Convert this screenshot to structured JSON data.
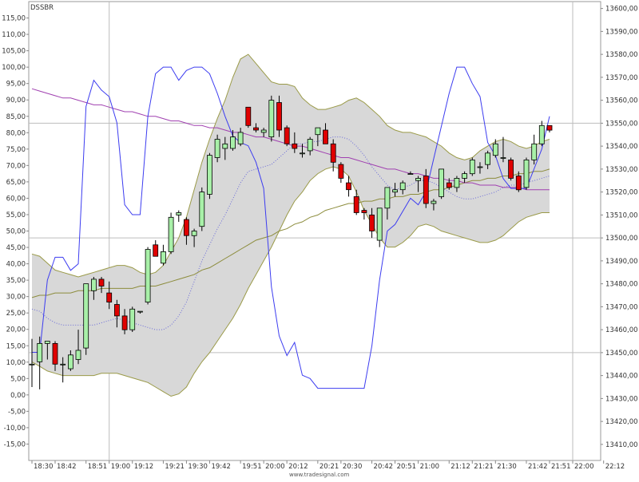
{
  "chart_data": {
    "type": "candlestick",
    "symbol": "DSSBR",
    "watermark": "www.tradesignal.com",
    "x_labels": [
      "18:30",
      "18:42",
      "18:51",
      "19:00",
      "19:12",
      "19:21",
      "19:30",
      "19:42",
      "19:51",
      "20:00",
      "20:12",
      "20:21",
      "20:30",
      "20:42",
      "20:51",
      "21:00",
      "21:12",
      "21:21",
      "21:30",
      "21:42",
      "21:51",
      "22:00",
      "22:12"
    ],
    "left_axis": {
      "range": [
        -20,
        120
      ],
      "tick_labels": [
        "115,00",
        "110,00",
        "105,00",
        "100,00",
        "95,00",
        "90,00",
        "85,00",
        "80,00",
        "75,00",
        "70,00",
        "65,00",
        "60,00",
        "55,00",
        "50,00",
        "45,00",
        "40,00",
        "35,00",
        "30,00",
        "25,00",
        "20,00",
        "15,00",
        "10,00",
        "5,00",
        "0,00",
        "-5,00",
        "-10,00",
        "-15,00"
      ]
    },
    "right_axis": {
      "range": [
        13403,
        13603
      ],
      "tick_labels": [
        "13600,00",
        "13590,00",
        "13580,00",
        "13570,00",
        "13560,00",
        "13550,00",
        "13540,00",
        "13530,00",
        "13520,00",
        "13510,00",
        "13500,00",
        "13490,00",
        "13480,00",
        "13470,00",
        "13460,00",
        "13450,00",
        "13440,00",
        "13430,00",
        "13420,00",
        "13410,00"
      ]
    },
    "grid_lines": [
      "12:00 vertical",
      "13450 / 13500 / 13550 horizontal"
    ],
    "candles": [
      {
        "o": 13445,
        "h": 13456,
        "l": 13435,
        "c": 13445
      },
      {
        "o": 13446,
        "h": 13457,
        "l": 13434,
        "c": 13454
      },
      {
        "o": 13454,
        "h": 13455,
        "l": 13447,
        "c": 13455
      },
      {
        "o": 13454,
        "h": 13455,
        "l": 13442,
        "c": 13445
      },
      {
        "o": 13445,
        "h": 13448,
        "l": 13437,
        "c": 13445
      },
      {
        "o": 13443,
        "h": 13451,
        "l": 13442,
        "c": 13449
      },
      {
        "o": 13447,
        "h": 13460,
        "l": 13445,
        "c": 13451
      },
      {
        "o": 13452,
        "h": 13480,
        "l": 13449,
        "c": 13480
      },
      {
        "o": 13477,
        "h": 13483,
        "l": 13473,
        "c": 13482
      },
      {
        "o": 13482,
        "h": 13483,
        "l": 13476,
        "c": 13479
      },
      {
        "o": 13476,
        "h": 13481,
        "l": 13469,
        "c": 13472
      },
      {
        "o": 13471,
        "h": 13473,
        "l": 13461,
        "c": 13466
      },
      {
        "o": 13466,
        "h": 13469,
        "l": 13458,
        "c": 13460
      },
      {
        "o": 13460,
        "h": 13470,
        "l": 13459,
        "c": 13469
      },
      {
        "o": 13468,
        "h": 13468,
        "l": 13467,
        "c": 13468
      },
      {
        "o": 13472,
        "h": 13496,
        "l": 13471,
        "c": 13495
      },
      {
        "o": 13497,
        "h": 13499,
        "l": 13493,
        "c": 13492
      },
      {
        "o": 13489,
        "h": 13497,
        "l": 13488,
        "c": 13494
      },
      {
        "o": 13494,
        "h": 13511,
        "l": 13493,
        "c": 13509
      },
      {
        "o": 13510,
        "h": 13512,
        "l": 13507,
        "c": 13511
      },
      {
        "o": 13508,
        "h": 13509,
        "l": 13497,
        "c": 13501
      },
      {
        "o": 13501,
        "h": 13504,
        "l": 13496,
        "c": 13503
      },
      {
        "o": 13505,
        "h": 13522,
        "l": 13503,
        "c": 13520
      },
      {
        "o": 13519,
        "h": 13537,
        "l": 13517,
        "c": 13536
      },
      {
        "o": 13535,
        "h": 13545,
        "l": 13533,
        "c": 13543
      },
      {
        "o": 13539,
        "h": 13544,
        "l": 13534,
        "c": 13541
      },
      {
        "o": 13539,
        "h": 13547,
        "l": 13538,
        "c": 13544
      },
      {
        "o": 13541,
        "h": 13548,
        "l": 13540,
        "c": 13546
      },
      {
        "o": 13557,
        "h": 13557,
        "l": 13548,
        "c": 13549
      },
      {
        "o": 13548,
        "h": 13550,
        "l": 13546,
        "c": 13547
      },
      {
        "o": 13546,
        "h": 13548,
        "l": 13544,
        "c": 13547
      },
      {
        "o": 13544,
        "h": 13562,
        "l": 13542,
        "c": 13560
      },
      {
        "o": 13559,
        "h": 13562,
        "l": 13544,
        "c": 13547
      },
      {
        "o": 13548,
        "h": 13549,
        "l": 13540,
        "c": 13541
      },
      {
        "o": 13541,
        "h": 13546,
        "l": 13537,
        "c": 13539
      },
      {
        "o": 13537,
        "h": 13541,
        "l": 13535,
        "c": 13537
      },
      {
        "o": 13538,
        "h": 13544,
        "l": 13536,
        "c": 13543
      },
      {
        "o": 13545,
        "h": 13547,
        "l": 13540,
        "c": 13548
      },
      {
        "o": 13547,
        "h": 13550,
        "l": 13541,
        "c": 13541
      },
      {
        "o": 13541,
        "h": 13543,
        "l": 13529,
        "c": 13533
      },
      {
        "o": 13532,
        "h": 13533,
        "l": 13524,
        "c": 13526
      },
      {
        "o": 13524,
        "h": 13527,
        "l": 13518,
        "c": 13521
      },
      {
        "o": 13518,
        "h": 13521,
        "l": 13510,
        "c": 13511
      },
      {
        "o": 13512,
        "h": 13513,
        "l": 13508,
        "c": 13511
      },
      {
        "o": 13510,
        "h": 13513,
        "l": 13500,
        "c": 13503
      },
      {
        "o": 13499,
        "h": 13503,
        "l": 13496,
        "c": 13513
      },
      {
        "o": 13513,
        "h": 13522,
        "l": 13508,
        "c": 13522
      },
      {
        "o": 13520,
        "h": 13524,
        "l": 13518,
        "c": 13521
      },
      {
        "o": 13521,
        "h": 13525,
        "l": 13519,
        "c": 13524
      },
      {
        "o": 13528,
        "h": 13529,
        "l": 13528,
        "c": 13528
      },
      {
        "o": 13525,
        "h": 13527,
        "l": 13520,
        "c": 13526
      },
      {
        "o": 13527,
        "h": 13530,
        "l": 13513,
        "c": 13515
      },
      {
        "o": 13515,
        "h": 13517,
        "l": 13512,
        "c": 13516
      },
      {
        "o": 13518,
        "h": 13530,
        "l": 13517,
        "c": 13530
      },
      {
        "o": 13524,
        "h": 13526,
        "l": 13521,
        "c": 13522
      },
      {
        "o": 13522,
        "h": 13527,
        "l": 13520,
        "c": 13526
      },
      {
        "o": 13526,
        "h": 13529,
        "l": 13524,
        "c": 13528
      },
      {
        "o": 13528,
        "h": 13535,
        "l": 13527,
        "c": 13534
      },
      {
        "o": 13531,
        "h": 13533,
        "l": 13528,
        "c": 13531
      },
      {
        "o": 13532,
        "h": 13538,
        "l": 13530,
        "c": 13537
      },
      {
        "o": 13536,
        "h": 13543,
        "l": 13535,
        "c": 13541
      },
      {
        "o": 13535,
        "h": 13544,
        "l": 13533,
        "c": 13535
      },
      {
        "o": 13534,
        "h": 13535,
        "l": 13525,
        "c": 13526
      },
      {
        "o": 13527,
        "h": 13529,
        "l": 13520,
        "c": 13521
      },
      {
        "o": 13522,
        "h": 13535,
        "l": 13521,
        "c": 13534
      },
      {
        "o": 13534,
        "h": 13545,
        "l": 13532,
        "c": 13541
      },
      {
        "o": 13541,
        "h": 13551,
        "l": 13540,
        "c": 13549
      },
      {
        "o": 13549,
        "h": 13549,
        "l": 13546,
        "c": 13547
      }
    ],
    "bollinger": {
      "upper": [
        13493,
        13492,
        13489,
        13486,
        13485,
        13484,
        13483,
        13484,
        13485,
        13486,
        13487,
        13488,
        13488,
        13487,
        13485,
        13484,
        13485,
        13488,
        13494,
        13500,
        13509,
        13521,
        13533,
        13543,
        13552,
        13560,
        13570,
        13578,
        13580,
        13576,
        13572,
        13568,
        13567,
        13567,
        13566,
        13561,
        13558,
        13556,
        13556,
        13557,
        13558,
        13560,
        13561,
        13559,
        13556,
        13553,
        13549,
        13547,
        13546,
        13546,
        13545,
        13544,
        13542,
        13540,
        13537,
        13535,
        13534,
        13535,
        13538,
        13540,
        13542,
        13543,
        13542,
        13540,
        13539,
        13540,
        13542,
        13543
      ],
      "lower": [
        13446,
        13444,
        13442,
        13441,
        13440,
        13440,
        13440,
        13440,
        13440,
        13441,
        13441,
        13441,
        13440,
        13439,
        13438,
        13437,
        13435,
        13433,
        13431,
        13432,
        13435,
        13441,
        13446,
        13450,
        13455,
        13460,
        13465,
        13471,
        13478,
        13484,
        13490,
        13496,
        13503,
        13510,
        13516,
        13520,
        13525,
        13528,
        13530,
        13531,
        13530,
        13527,
        13520,
        13512,
        13506,
        13500,
        13496,
        13496,
        13498,
        13501,
        13505,
        13506,
        13505,
        13503,
        13502,
        13501,
        13500,
        13499,
        13498,
        13498,
        13499,
        13501,
        13504,
        13507,
        13509,
        13510,
        13511,
        13511
      ],
      "middle": [
        13469,
        13468,
        13465,
        13463,
        13462,
        13462,
        13462,
        13462,
        13462,
        13463,
        13464,
        13465,
        13464,
        13463,
        13462,
        13461,
        13460,
        13460,
        13462,
        13466,
        13472,
        13481,
        13490,
        13497,
        13504,
        13510,
        13517,
        13524,
        13529,
        13530,
        13531,
        13532,
        13535,
        13538,
        13541,
        13541,
        13542,
        13542,
        13543,
        13544,
        13544,
        13543,
        13540,
        13536,
        13531,
        13527,
        13523,
        13521,
        13522,
        13523,
        13525,
        13525,
        13524,
        13522,
        13520,
        13518,
        13517,
        13517,
        13518,
        13519,
        13520,
        13522,
        13523,
        13523,
        13524,
        13525,
        13526,
        13527
      ]
    },
    "moving_average_slow": [
      13474,
      13475,
      13475,
      13476,
      13476,
      13476,
      13477,
      13477,
      13477,
      13478,
      13478,
      13478,
      13478,
      13478,
      13479,
      13479,
      13479,
      13480,
      13481,
      13482,
      13483,
      13484,
      13486,
      13487,
      13489,
      13491,
      13493,
      13495,
      13497,
      13499,
      13500,
      13501,
      13503,
      13504,
      13506,
      13507,
      13509,
      13510,
      13512,
      13513,
      13514,
      13515,
      13515,
      13516,
      13516,
      13517,
      13517,
      13518,
      13518,
      13519,
      13519,
      13520,
      13521,
      13521,
      13522,
      13523,
      13524,
      13525,
      13525,
      13526,
      13526,
      13527,
      13527,
      13528,
      13528,
      13529,
      13529,
      13530
    ],
    "trend_line": [
      13565,
      13564,
      13563,
      13562,
      13561,
      13561,
      13560,
      13559,
      13558,
      13558,
      13557,
      13556,
      13555,
      13555,
      13554,
      13553,
      13553,
      13552,
      13551,
      13551,
      13550,
      13549,
      13549,
      13548,
      13548,
      13547,
      13546,
      13546,
      13545,
      13544,
      13544,
      13543,
      13542,
      13541,
      13540,
      13540,
      13539,
      13538,
      13537,
      13536,
      13535,
      13535,
      13534,
      13533,
      13532,
      13531,
      13530,
      13530,
      13529,
      13528,
      13528,
      13527,
      13526,
      13526,
      13525,
      13525,
      13524,
      13524,
      13523,
      13523,
      13523,
      13522,
      13522,
      13522,
      13521,
      13521,
      13521,
      13521
    ],
    "oscillator": [
      13,
      13,
      35,
      42,
      42,
      38,
      40,
      88,
      96,
      93,
      91,
      83,
      58,
      55,
      55,
      85,
      98,
      100,
      100,
      96,
      99,
      100,
      100,
      98,
      92,
      85,
      79,
      77,
      76,
      71,
      63,
      33,
      18,
      12,
      16,
      6,
      5,
      2,
      2,
      2,
      2,
      2,
      2,
      2,
      15,
      35,
      50,
      52,
      56,
      60,
      58,
      62,
      72,
      82,
      92,
      100,
      100,
      95,
      91,
      77,
      73,
      66,
      63,
      63,
      63,
      69,
      75,
      85
    ]
  }
}
